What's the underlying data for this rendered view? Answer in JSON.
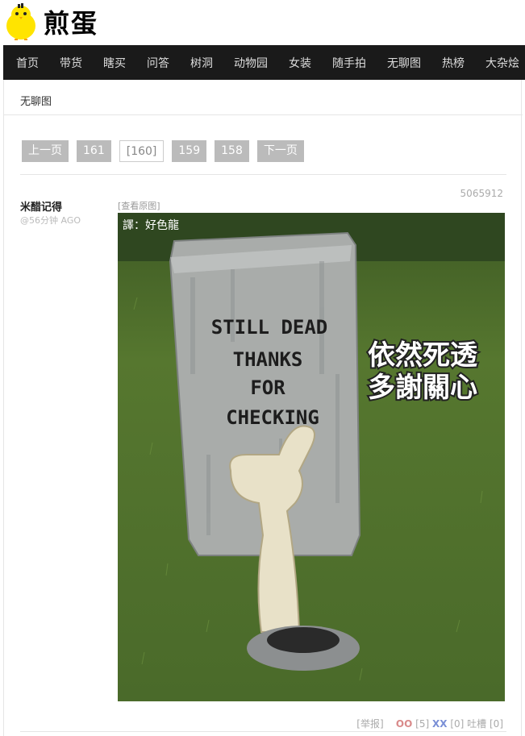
{
  "site": {
    "logo_text": "煎蛋"
  },
  "nav": [
    "首页",
    "带货",
    "瞎买",
    "问答",
    "树洞",
    "动物园",
    "女装",
    "随手拍",
    "无聊图",
    "热榜",
    "大杂烩"
  ],
  "breadcrumb": "无聊图",
  "pager": {
    "prev": "上一页",
    "pages": [
      "161",
      "[160]",
      "159",
      "158"
    ],
    "next": "下一页"
  },
  "post": {
    "id": "5065912",
    "author": "米醋记得",
    "time": "@56分钟 AGO",
    "view_original": "[查看原图]",
    "image": {
      "credit": "譯：好色龍",
      "tombstone": [
        "STILL DEAD",
        "THANKS",
        "FOR",
        "CHECKING"
      ],
      "caption": [
        "依然死透",
        "多謝關心"
      ]
    },
    "footer": {
      "report": "[举报]",
      "oo": "OO",
      "oo_count": "[5]",
      "xx": "XX",
      "xx_count": "[0]",
      "tucao": "吐槽",
      "tucao_count": "[0]"
    }
  }
}
